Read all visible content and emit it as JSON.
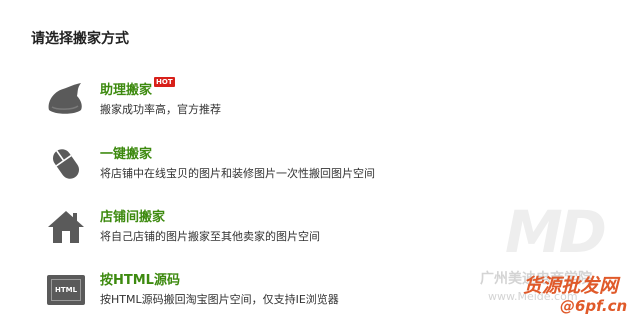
{
  "page": {
    "title": "请选择搬家方式"
  },
  "options": [
    {
      "icon": "hat-icon",
      "title": "助理搬家",
      "badge": "HOT",
      "desc": "搬家成功率高，官方推荐"
    },
    {
      "icon": "mouse-icon",
      "title": "一键搬家",
      "desc": "将店铺中在线宝贝的图片和装修图片一次性搬回图片空间"
    },
    {
      "icon": "house-icon",
      "title": "店铺间搬家",
      "desc": "将自己店铺的图片搬家至其他卖家的图片空间"
    },
    {
      "icon": "html-icon",
      "icon_label": "HTML",
      "title": "按HTML源码",
      "desc": "按HTML源码搬回淘宝图片空间，仅支持IE浏览器"
    }
  ],
  "watermark": {
    "logo": "MD",
    "cn": "广州美迪电商学院",
    "url": "www.Meide.com",
    "red1": "货源批发网",
    "red2": "@6pf.cn"
  },
  "colors": {
    "title_green": "#3d8a0f",
    "icon_gray": "#5a5a5a",
    "hot_red": "#d8201a"
  }
}
